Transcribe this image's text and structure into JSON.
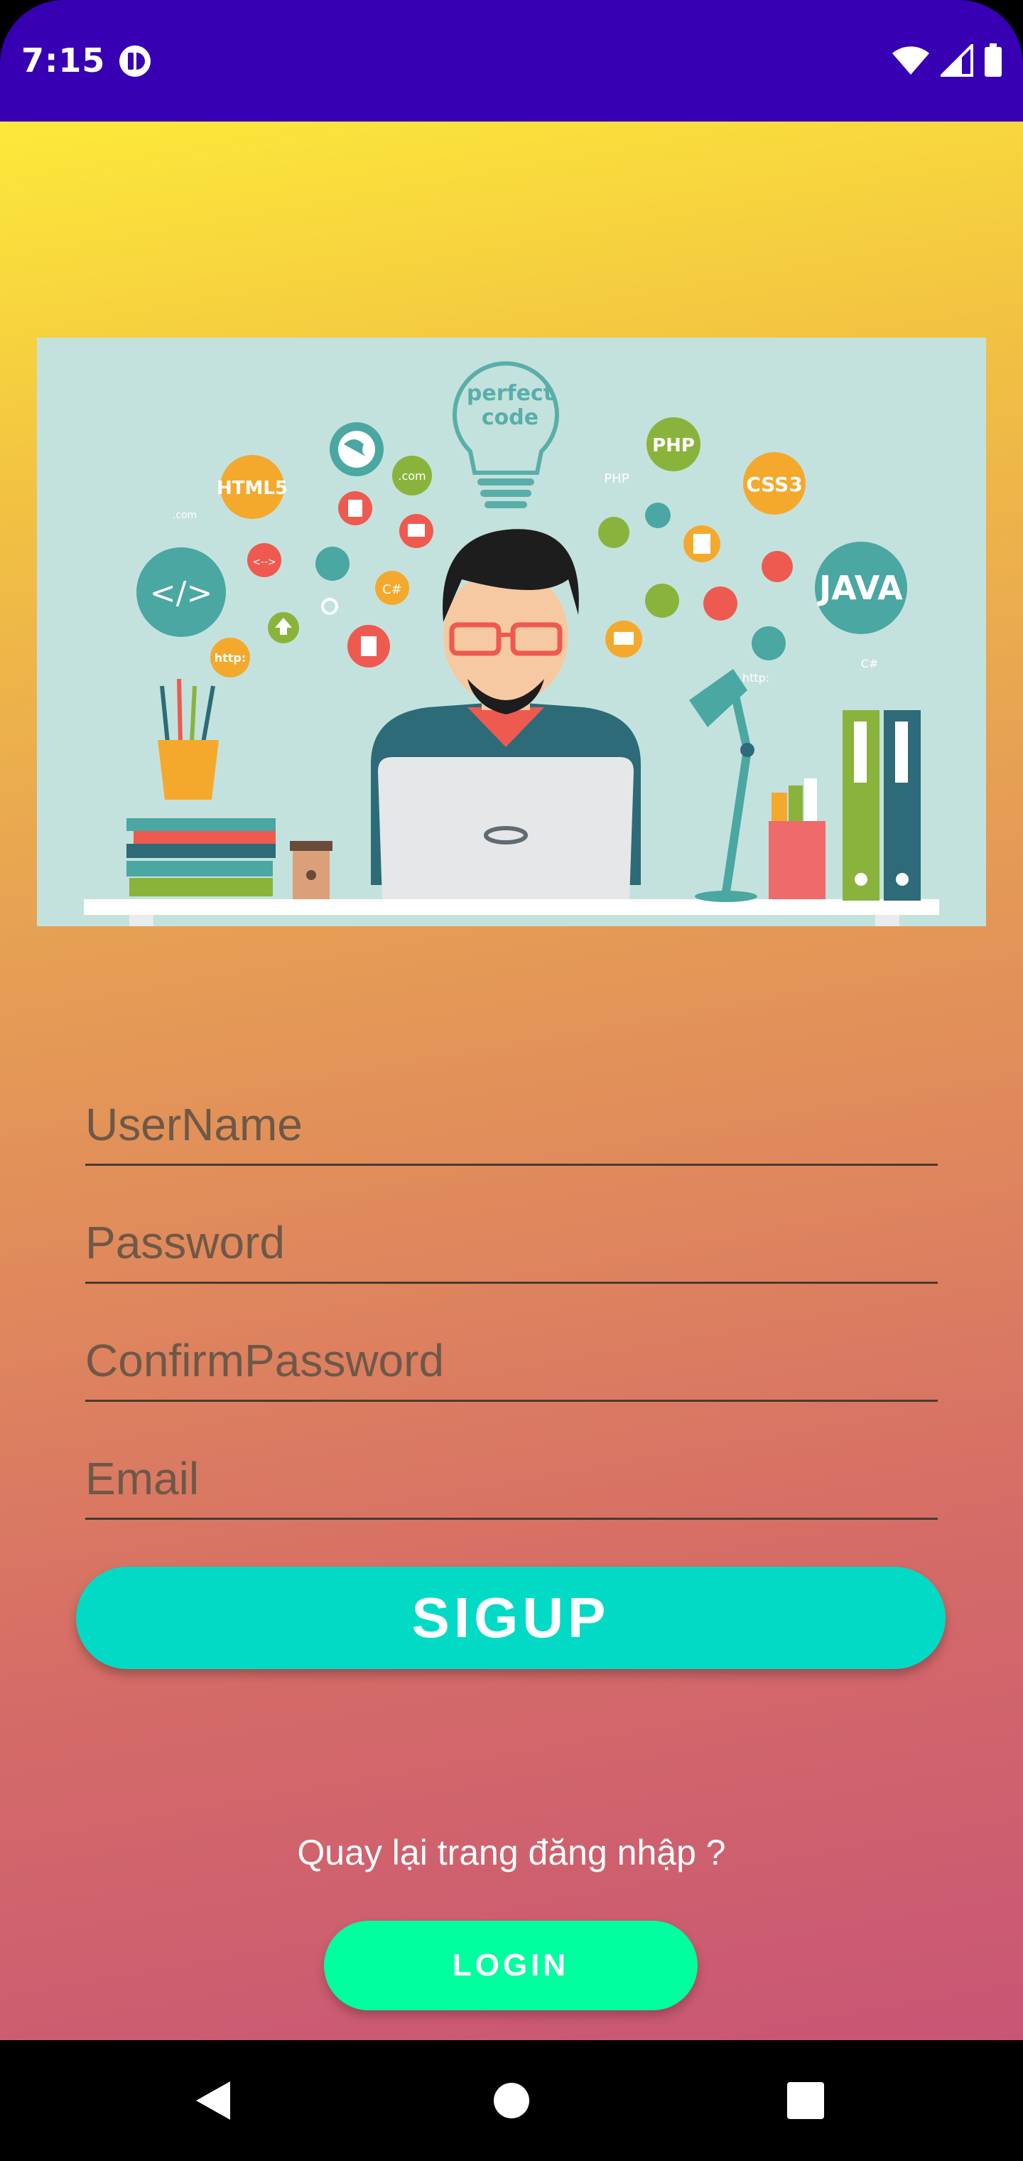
{
  "status_bar": {
    "time": "7:15",
    "background": "#3700B3",
    "icons": [
      "app-notification-icon",
      "wifi-icon",
      "cell-signal-icon",
      "battery-icon"
    ]
  },
  "hero_image": {
    "description_icon": "developer-illustration",
    "texts": {
      "bulb": [
        "perfect",
        "code"
      ],
      "html5": "HTML5",
      "php": "PHP",
      "php_small": "PHP",
      "css3": "CSS3",
      "java": "JAVA",
      "code_tag": "</>",
      "com": ".com",
      "com_small": ".com",
      "http": "http:",
      "http_small": "http:",
      "csharp": "C#",
      "csharp_small": "C#"
    }
  },
  "form": {
    "username_placeholder": "UserName",
    "password_placeholder": "Password",
    "confirm_password_placeholder": "ConfirmPassword",
    "email_placeholder": "Email",
    "signup_label": "SIGUP",
    "back_to_login_text": "Quay lại trang đăng nhập ?",
    "login_label": "LOGIN",
    "signup_color": "#03DAC5",
    "login_color": "#00FF9F"
  },
  "nav_bar": {
    "icons": [
      "back-icon",
      "home-icon",
      "recents-icon"
    ]
  }
}
